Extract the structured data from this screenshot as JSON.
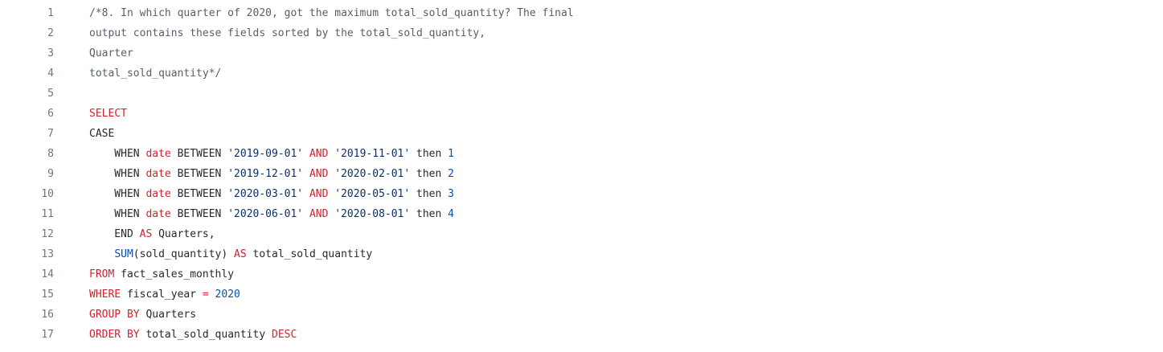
{
  "lines": [
    {
      "n": "1",
      "tokens": [
        {
          "t": "cm",
          "v": "/*8. In which quarter of 2020, got the maximum total_sold_quantity? The final"
        }
      ]
    },
    {
      "n": "2",
      "tokens": [
        {
          "t": "cm",
          "v": "output contains these fields sorted by the total_sold_quantity,"
        }
      ]
    },
    {
      "n": "3",
      "tokens": [
        {
          "t": "cm",
          "v": "Quarter"
        }
      ]
    },
    {
      "n": "4",
      "tokens": [
        {
          "t": "cm",
          "v": "total_sold_quantity*/"
        }
      ]
    },
    {
      "n": "5",
      "tokens": []
    },
    {
      "n": "6",
      "tokens": [
        {
          "t": "kw",
          "v": "SELECT"
        }
      ]
    },
    {
      "n": "7",
      "tokens": [
        {
          "t": "pl",
          "v": "CASE"
        }
      ]
    },
    {
      "n": "8",
      "tokens": [
        {
          "t": "pl",
          "v": "    WHEN "
        },
        {
          "t": "kw",
          "v": "date"
        },
        {
          "t": "pl",
          "v": " BETWEEN "
        },
        {
          "t": "str",
          "v": "'2019-09-01'"
        },
        {
          "t": "pl",
          "v": " "
        },
        {
          "t": "kw",
          "v": "AND"
        },
        {
          "t": "pl",
          "v": " "
        },
        {
          "t": "str",
          "v": "'2019-11-01'"
        },
        {
          "t": "pl",
          "v": " then "
        },
        {
          "t": "num",
          "v": "1"
        }
      ]
    },
    {
      "n": "9",
      "tokens": [
        {
          "t": "pl",
          "v": "    WHEN "
        },
        {
          "t": "kw",
          "v": "date"
        },
        {
          "t": "pl",
          "v": " BETWEEN "
        },
        {
          "t": "str",
          "v": "'2019-12-01'"
        },
        {
          "t": "pl",
          "v": " "
        },
        {
          "t": "kw",
          "v": "AND"
        },
        {
          "t": "pl",
          "v": " "
        },
        {
          "t": "str",
          "v": "'2020-02-01'"
        },
        {
          "t": "pl",
          "v": " then "
        },
        {
          "t": "num",
          "v": "2"
        }
      ]
    },
    {
      "n": "10",
      "tokens": [
        {
          "t": "pl",
          "v": "    WHEN "
        },
        {
          "t": "kw",
          "v": "date"
        },
        {
          "t": "pl",
          "v": " BETWEEN "
        },
        {
          "t": "str",
          "v": "'2020-03-01'"
        },
        {
          "t": "pl",
          "v": " "
        },
        {
          "t": "kw",
          "v": "AND"
        },
        {
          "t": "pl",
          "v": " "
        },
        {
          "t": "str",
          "v": "'2020-05-01'"
        },
        {
          "t": "pl",
          "v": " then "
        },
        {
          "t": "num",
          "v": "3"
        }
      ]
    },
    {
      "n": "11",
      "tokens": [
        {
          "t": "pl",
          "v": "    WHEN "
        },
        {
          "t": "kw",
          "v": "date"
        },
        {
          "t": "pl",
          "v": " BETWEEN "
        },
        {
          "t": "str",
          "v": "'2020-06-01'"
        },
        {
          "t": "pl",
          "v": " "
        },
        {
          "t": "kw",
          "v": "AND"
        },
        {
          "t": "pl",
          "v": " "
        },
        {
          "t": "str",
          "v": "'2020-08-01'"
        },
        {
          "t": "pl",
          "v": " then "
        },
        {
          "t": "num",
          "v": "4"
        }
      ]
    },
    {
      "n": "12",
      "tokens": [
        {
          "t": "pl",
          "v": "    END "
        },
        {
          "t": "kw",
          "v": "AS"
        },
        {
          "t": "pl",
          "v": " Quarters,"
        }
      ]
    },
    {
      "n": "13",
      "tokens": [
        {
          "t": "pl",
          "v": "    "
        },
        {
          "t": "fn",
          "v": "SUM"
        },
        {
          "t": "pl",
          "v": "(sold_quantity) "
        },
        {
          "t": "kw",
          "v": "AS"
        },
        {
          "t": "pl",
          "v": " total_sold_quantity"
        }
      ]
    },
    {
      "n": "14",
      "tokens": [
        {
          "t": "kw",
          "v": "FROM"
        },
        {
          "t": "pl",
          "v": " fact_sales_monthly"
        }
      ]
    },
    {
      "n": "15",
      "tokens": [
        {
          "t": "kw",
          "v": "WHERE"
        },
        {
          "t": "pl",
          "v": " fiscal_year "
        },
        {
          "t": "kw",
          "v": "="
        },
        {
          "t": "pl",
          "v": " "
        },
        {
          "t": "num",
          "v": "2020"
        }
      ]
    },
    {
      "n": "16",
      "tokens": [
        {
          "t": "kw",
          "v": "GROUP"
        },
        {
          "t": "pl",
          "v": " "
        },
        {
          "t": "kw",
          "v": "BY"
        },
        {
          "t": "pl",
          "v": " Quarters"
        }
      ]
    },
    {
      "n": "17",
      "tokens": [
        {
          "t": "kw",
          "v": "ORDER"
        },
        {
          "t": "pl",
          "v": " "
        },
        {
          "t": "kw",
          "v": "BY"
        },
        {
          "t": "pl",
          "v": " total_sold_quantity "
        },
        {
          "t": "kw",
          "v": "DESC"
        }
      ]
    }
  ]
}
